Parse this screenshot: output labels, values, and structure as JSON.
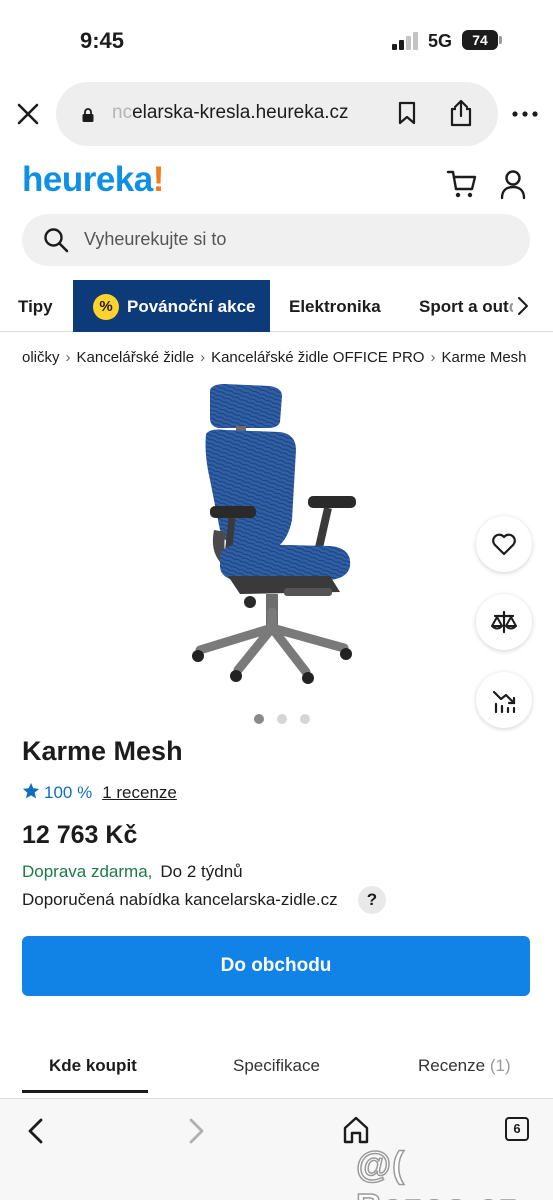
{
  "status_bar": {
    "time": "9:45",
    "network": "5G",
    "battery": "74"
  },
  "browser": {
    "url_faded": "nc",
    "url_main": "elarska-kresla.heureka.cz",
    "tab_count": "6"
  },
  "header": {
    "logo_main": "heureka",
    "logo_accent": "!",
    "search_placeholder": "Vyheurekujte si to"
  },
  "categories": [
    {
      "label": "Tipy"
    },
    {
      "label": "Povánoční akce",
      "badge": "%"
    },
    {
      "label": "Elektronika"
    },
    {
      "label": "Sport a out",
      "faded": "do"
    }
  ],
  "breadcrumbs": [
    "oličky",
    "Kancelářské židle",
    "Kancelářské židle OFFICE PRO",
    "Karme Mesh"
  ],
  "product": {
    "title": "Karme Mesh",
    "rating_percent": "100 %",
    "reviews": "1 recenze",
    "price": "12 763 Kč",
    "shipping": "Doprava zdarma,",
    "delivery": "Do 2 týdnů",
    "offer": "Doporučená nabídka kancelarska-zidle.cz",
    "help": "?",
    "cta": "Do obchodu",
    "image_index": 1,
    "image_count": 3
  },
  "product_tabs": [
    {
      "label": "Kde koupit"
    },
    {
      "label": "Specifikace"
    },
    {
      "label": "Recenze",
      "count": "(1)"
    }
  ],
  "watermark": "@( Bazos.cz",
  "colors": {
    "brand_blue": "#0f8fe6",
    "brand_orange": "#f47a20",
    "active_category_bg": "#0d3b7a",
    "cta_bg": "#1283e6",
    "chair_blue": "#2f5fa6"
  },
  "icons": [
    "close-icon",
    "lock-icon",
    "bookmark-icon",
    "share-icon",
    "more-icon",
    "cart-icon",
    "user-icon",
    "search-icon",
    "chevron-right-icon",
    "heart-icon",
    "compare-icon",
    "price-history-icon",
    "star-icon",
    "back-icon",
    "forward-icon",
    "home-icon",
    "tabs-icon"
  ]
}
